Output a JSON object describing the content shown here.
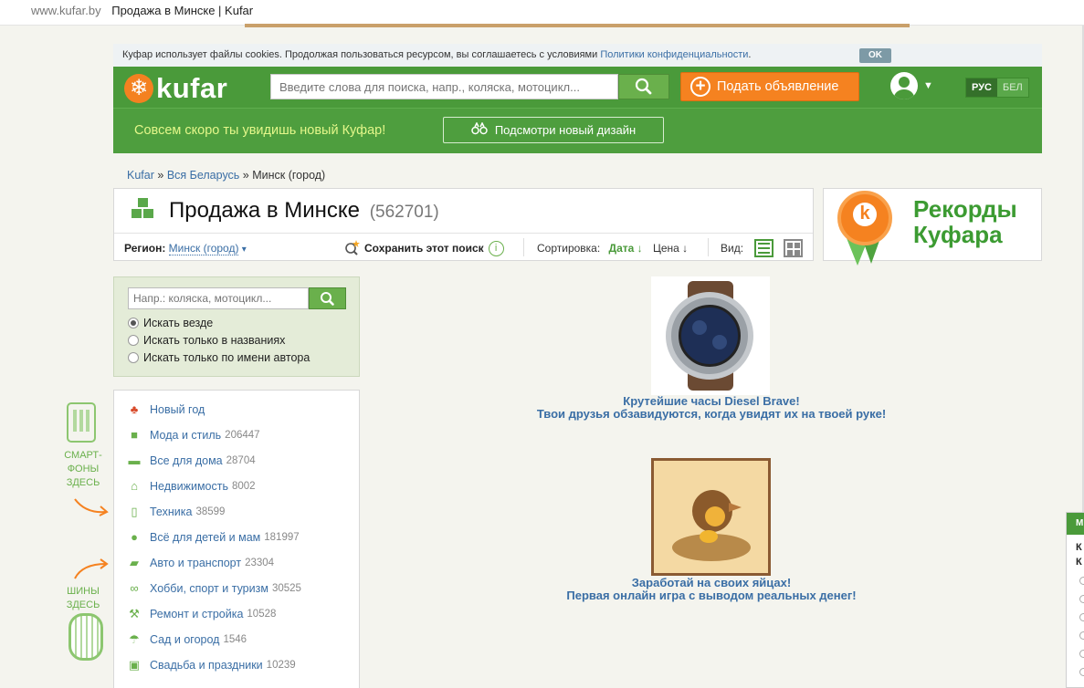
{
  "browser": {
    "url": "www.kufar.by",
    "title": "Продажа в Минске | Kufar"
  },
  "cookie": {
    "text": "Куфар использует файлы cookies. Продолжая пользоваться ресурсом, вы соглашаетесь с условиями ",
    "link": "Политики конфиденциальности",
    "dot": ".",
    "ok": "OK"
  },
  "header": {
    "logo": "kufar",
    "search_placeholder": "Введите слова для поиска, напр., коляска, мотоцикл...",
    "post_button": "Подать объявление",
    "lang_ru": "РУС",
    "lang_be": "БЕЛ"
  },
  "promo": {
    "text": "Совсем скоро ты увидишь новый Куфар!",
    "button": "Подсмотри новый дизайн"
  },
  "breadcrumbs": {
    "home": "Kufar",
    "sep1": "»",
    "region": "Вся Беларусь",
    "sep2": "»",
    "city": "Минск (город)"
  },
  "listing": {
    "title": "Продажа в Минске",
    "count": "(562701)",
    "region_label": "Регион:",
    "region_value": "Минск (город)",
    "region_caret": "▾",
    "save_search": "Сохранить этот поиск",
    "sort_label": "Сортировка:",
    "sort_date": "Дата ↓",
    "sort_price": "Цена ↓",
    "view_label": "Вид:"
  },
  "records": {
    "line1": "Рекорды",
    "line2": "Куфара",
    "medal_letter": "k"
  },
  "side_search": {
    "placeholder": "Напр.: коляска, мотоцикл...",
    "options": [
      "Искать везде",
      "Искать только в названиях",
      "Искать только по имени автора"
    ],
    "selected": 0
  },
  "categories": [
    {
      "label": "Новый год",
      "count": "",
      "icon": "tree-icon"
    },
    {
      "label": "Мода и стиль",
      "count": "206447",
      "icon": "shirt-icon"
    },
    {
      "label": "Все для дома",
      "count": "28704",
      "icon": "sofa-icon"
    },
    {
      "label": "Недвижимость",
      "count": "8002",
      "icon": "house-icon"
    },
    {
      "label": "Техника",
      "count": "38599",
      "icon": "phone-icon"
    },
    {
      "label": "Всё для детей и мам",
      "count": "181997",
      "icon": "teddy-icon"
    },
    {
      "label": "Авто и транспорт",
      "count": "23304",
      "icon": "truck-icon"
    },
    {
      "label": "Хобби, спорт и туризм",
      "count": "30525",
      "icon": "bike-icon"
    },
    {
      "label": "Ремонт и стройка",
      "count": "10528",
      "icon": "hammer-icon"
    },
    {
      "label": "Сад и огород",
      "count": "1546",
      "icon": "watering-can-icon"
    },
    {
      "label": "Свадьба и праздники",
      "count": "10239",
      "icon": "gift-icon"
    }
  ],
  "side_promos": {
    "smartphones": [
      "СМАРТ-",
      "ФОНЫ",
      "ЗДЕСЬ"
    ],
    "tires": [
      "ШИНЫ",
      "ЗДЕСЬ"
    ]
  },
  "ads": [
    {
      "line1": "Крутейшие часы Diesel Brave!",
      "line2": "Твои друзья обзавидуются, когда увидят их на твоей руке!"
    },
    {
      "line1": "Заработай на своих яйцах!",
      "line2": "Первая онлайн игра с выводом реальных денег!"
    }
  ],
  "edge_widget": {
    "tab": "М",
    "l1": "К",
    "l2": "К"
  },
  "colors": {
    "brand_green": "#4a9a3a",
    "accent_orange": "#f58220",
    "link_blue": "#3a6ea5",
    "promo_text": "#e4f78a"
  }
}
